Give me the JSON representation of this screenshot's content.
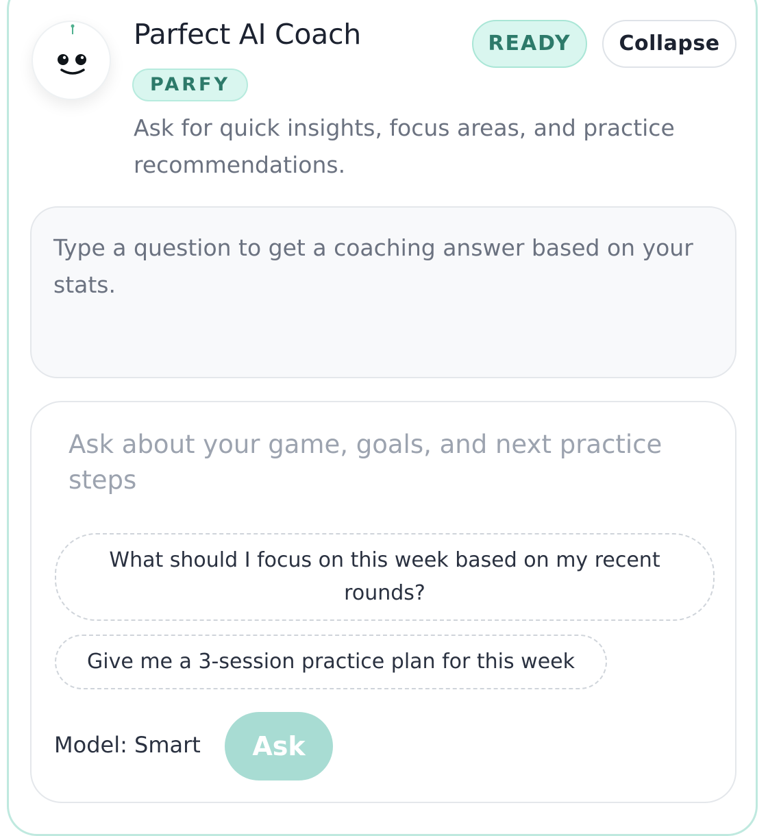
{
  "header": {
    "title": "Parfect AI Coach",
    "tag": "PARFY",
    "subtitle": "Ask for quick insights, focus areas, and practice recommendations.",
    "status": "READY",
    "collapse_label": "Collapse",
    "avatar_icon": "smiley-robot-icon"
  },
  "answer": {
    "text": "Type a question to get a coaching answer based on your stats."
  },
  "ask_panel": {
    "input_value": "",
    "input_placeholder": "Ask about your game, goals, and next practice steps",
    "suggestions": [
      {
        "label": "What should I focus on this week based on my recent rounds?"
      },
      {
        "label": "Give me a 3-session practice plan for this week"
      }
    ],
    "model_label": "Model: Smart",
    "ask_label": "Ask"
  },
  "colors": {
    "accent": "#a8dcd3",
    "accent_text": "#2d7a6a",
    "badge_bg": "#d9f6ef",
    "card_border": "#bfe9df"
  }
}
